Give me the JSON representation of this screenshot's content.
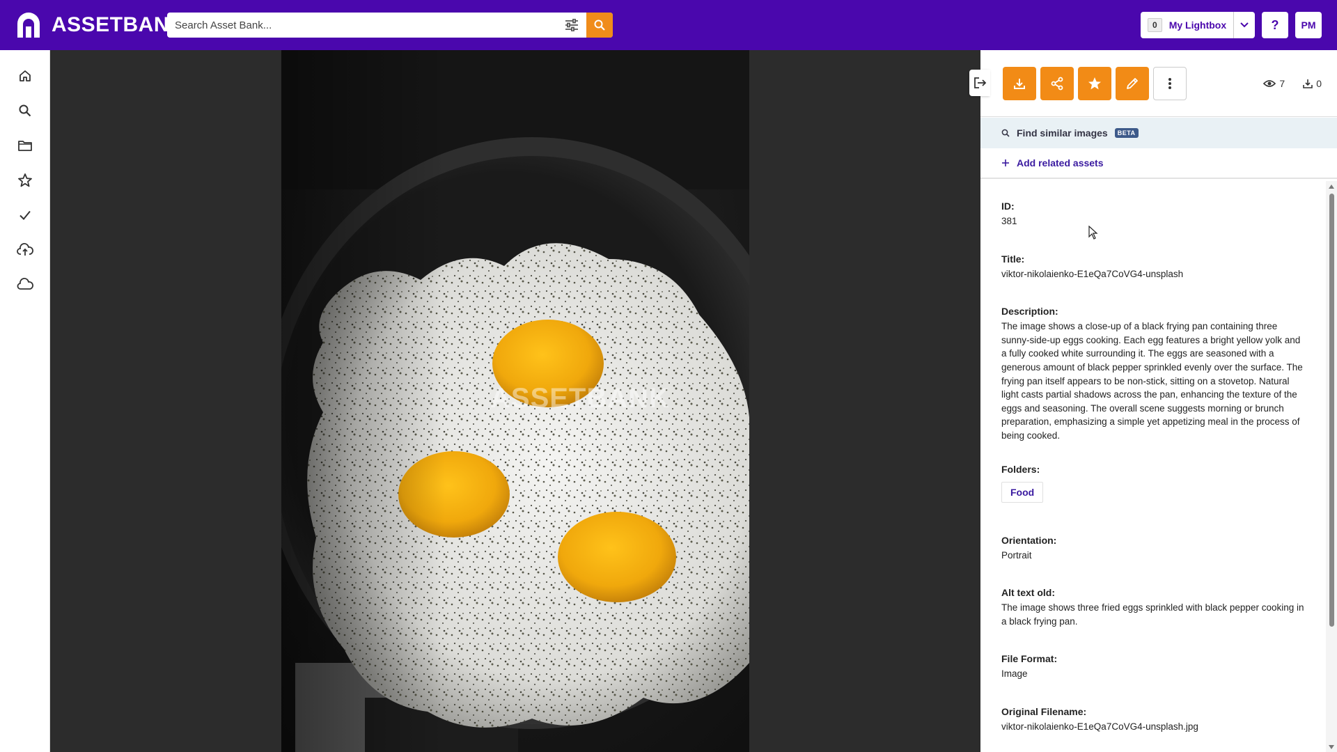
{
  "app": {
    "name": "ASSETBANK"
  },
  "search": {
    "placeholder": "Search Asset Bank..."
  },
  "header": {
    "lightbox_count": "0",
    "lightbox_label": "My Lightbox",
    "help_label": "?",
    "user_initials": "PM"
  },
  "nav": {
    "items": [
      "home-icon",
      "search-icon",
      "folder-icon",
      "star-icon",
      "check-icon",
      "cloud-upload-icon",
      "cloud-icon"
    ]
  },
  "viewer": {
    "watermark": "ASSETBANK"
  },
  "panel": {
    "actions": [
      "download-icon",
      "share-icon",
      "star-icon",
      "edit-icon",
      "more-icon"
    ],
    "stats": {
      "views": "7",
      "downloads": "0"
    },
    "find_similar": "Find similar images",
    "beta_label": "BETA",
    "add_related": "Add related assets",
    "fields": {
      "id_label": "ID:",
      "id_value": "381",
      "title_label": "Title:",
      "title_value": "viktor-nikolaienko-E1eQa7CoVG4-unsplash",
      "description_label": "Description:",
      "description_value": "The image shows a close-up of a black frying pan containing three sunny-side-up eggs cooking. Each egg features a bright yellow yolk and a fully cooked white surrounding it. The eggs are seasoned with a generous amount of black pepper sprinkled evenly over the surface. The frying pan itself appears to be non-stick, sitting on a stovetop. Natural light casts partial shadows across the pan, enhancing the texture of the eggs and seasoning. The overall scene suggests morning or brunch preparation, emphasizing a simple yet appetizing meal in the process of being cooked.",
      "folders_label": "Folders:",
      "folder_tag": "Food",
      "orientation_label": "Orientation:",
      "orientation_value": "Portrait",
      "alt_label": "Alt text old:",
      "alt_value": "The image shows three fried eggs sprinkled with black pepper cooking in a black frying pan.",
      "format_label": "File Format:",
      "format_value": "Image",
      "filename_label": "Original Filename:",
      "filename_value": "viktor-nikolaienko-E1eQa7CoVG4-unsplash.jpg"
    }
  },
  "colors": {
    "brand_purple": "#4a07ad",
    "accent_orange": "#f28b16",
    "link_purple": "#3a1aa0"
  }
}
